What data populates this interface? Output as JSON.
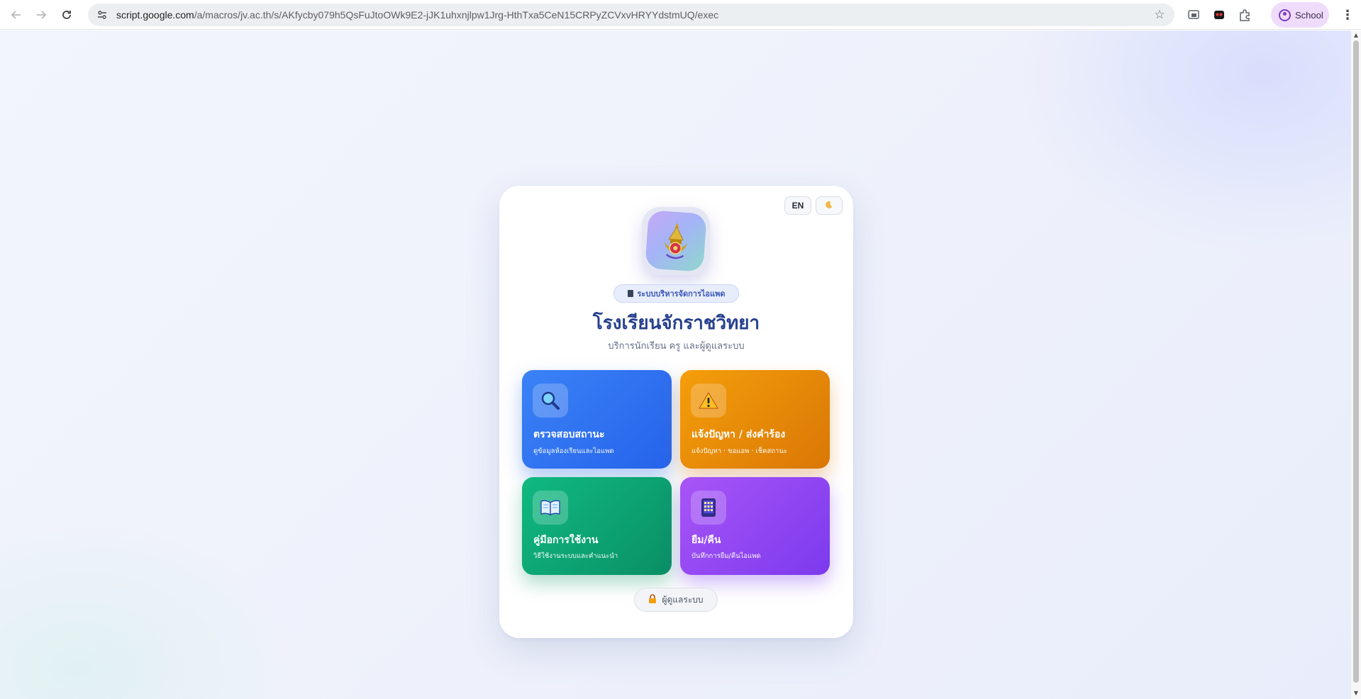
{
  "browser": {
    "url_host": "script.google.com",
    "url_path": "/a/macros/jv.ac.th/s/AKfycby079h5QsFuJtoOWk9E2-jJK1uhxnjlpw1Jrg-HthTxa5CeN15CRPyZCVxvHRYYdstmUQ/exec",
    "profile_label": "School",
    "icons": [
      "back-icon",
      "forward-icon",
      "reload-icon",
      "site-info-icon",
      "bookmark-star-icon",
      "cast-icon",
      "extension-icon",
      "puzzle-icon",
      "profile-icon",
      "menu-kebab-icon"
    ]
  },
  "card": {
    "lang_button": "EN",
    "theme_icon": "moon-icon",
    "badge_label": "ระบบบริหารจัดการไอแพด",
    "title": "โรงเรียนจักราชวิทยา",
    "subtitle": "บริการนักเรียน ครู และผู้ดูแลระบบ",
    "tiles": [
      {
        "title": "ตรวจสอบสถานะ",
        "subtitle": "ดูข้อมูลห้องเรียนและไอแพด",
        "icon": "magnifier-icon",
        "color": "#2563eb"
      },
      {
        "title": "แจ้งปัญหา / ส่งคำร้อง",
        "subtitle": "แจ้งปัญหา · ขอแอพ · เช็คสถานะ",
        "icon": "warning-icon",
        "color": "#d97706"
      },
      {
        "title": "คู่มือการใช้งาน",
        "subtitle": "วิธีใช้งานระบบและคำแนะนำ",
        "icon": "open-book-icon",
        "color": "#0a8f64"
      },
      {
        "title": "ยืม/คืน",
        "subtitle": "บันทึกการยืม/คืนไอแพด",
        "icon": "tablet-icon",
        "color": "#7c3aed"
      }
    ],
    "admin_button": "ผู้ดูแลระบบ",
    "admin_icon": "lock-icon"
  }
}
